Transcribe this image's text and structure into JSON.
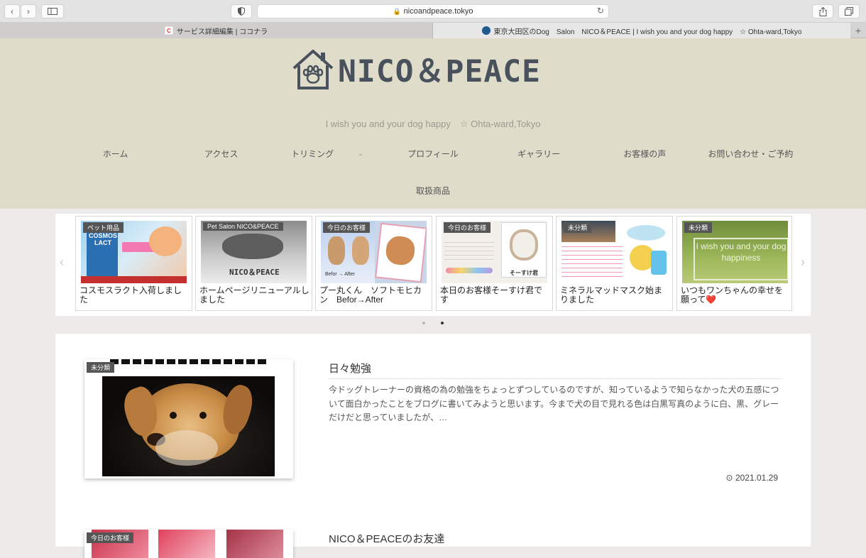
{
  "browser": {
    "url": "nicoandpeace.tokyo",
    "tabs": [
      {
        "title": "サービス詳細編集 | ココナラ",
        "favicon_letter": "C"
      },
      {
        "title": "東京大田区のDog　Salon　NICO＆PEACE | I wish you and your dog happy　☆ Ohta-ward,Tokyo"
      }
    ]
  },
  "site": {
    "logo_text": "NICO＆PEACE",
    "tagline": "I wish you and your dog happy　☆ Ohta-ward,Tokyo",
    "nav": [
      "ホーム",
      "アクセス",
      "トリミング",
      "プロフィール",
      "ギャラリー",
      "お客様の声",
      "お問い合わせ・ご予約",
      "取扱商品"
    ]
  },
  "carousel": {
    "cards": [
      {
        "badge": "ペット用品",
        "title": "コスモスラクト入荷しました",
        "thumb_text": "COSMOS LACT"
      },
      {
        "badge": "Pet Salon NICO&PEACE",
        "title": "ホームページリニューアルしました",
        "thumb_text": "NICO＆PEACE"
      },
      {
        "badge": "今日のお客様",
        "title": "プー丸くん　ソフトモヒカン　Befor→After",
        "thumb_text": "Befor → After"
      },
      {
        "badge": "今日のお客様",
        "title": "本日のお客様そーすけ君です",
        "thumb_text": "そーすけ君"
      },
      {
        "badge": "未分類",
        "title": "ミネラルマッドマスク始まりました",
        "thumb_text": ""
      },
      {
        "badge": "未分類",
        "title": "いつもワンちゃんの幸せを願って❤️",
        "thumb_text": "I wish you and your dog happiness"
      }
    ],
    "active_page": 2,
    "pages": 2
  },
  "posts": [
    {
      "badge": "未分類",
      "title": "日々勉強",
      "excerpt": "今ドッグトレーナーの資格の為の勉強をちょっとずつしているのですが、知っているようで知らなかった犬の五感について面白かったことをブログに書いてみようと思います。今まで犬の目で見れる色は白黒写真のように白、黒、グレーだけだと思っていましたが、…",
      "date": "2021.01.29"
    },
    {
      "badge": "今日のお客様",
      "title": "NICO＆PEACEのお友達"
    }
  ]
}
